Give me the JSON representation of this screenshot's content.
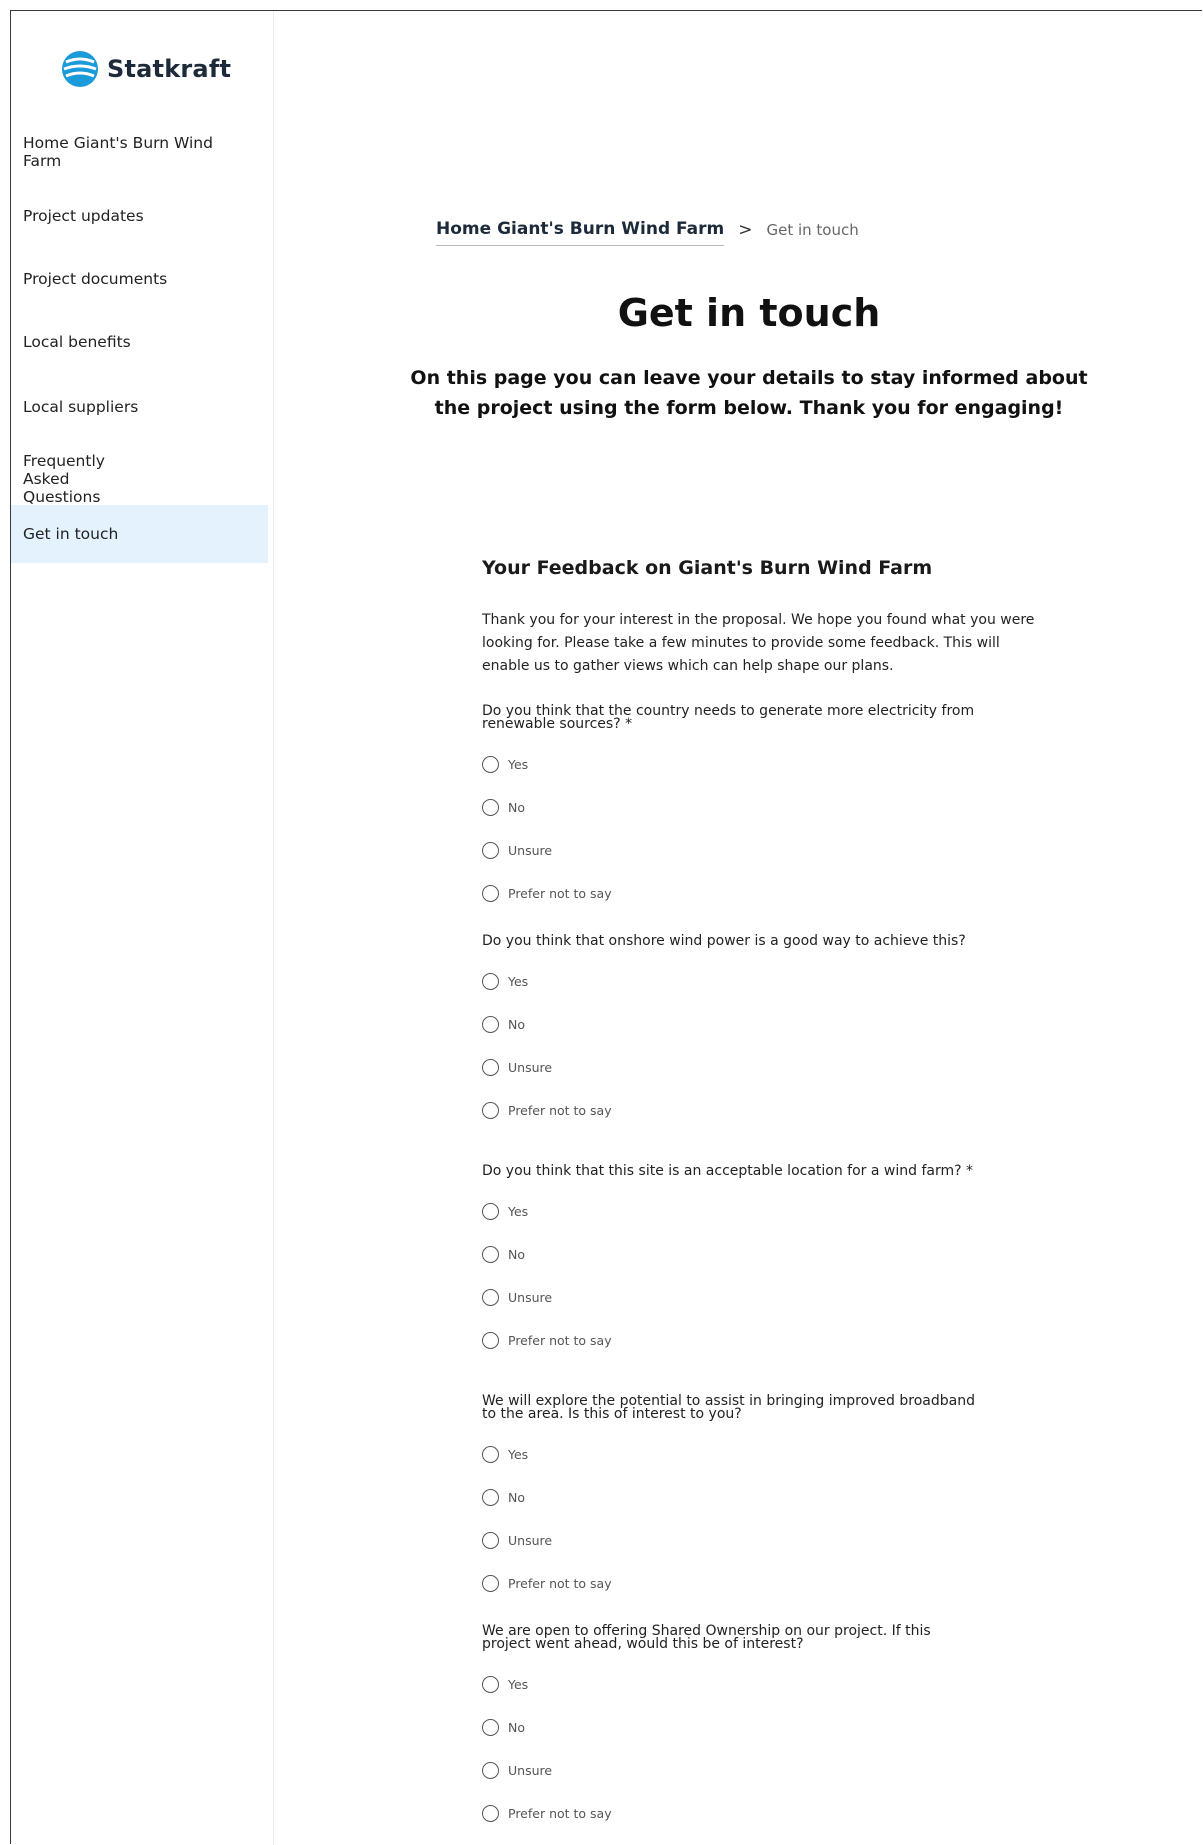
{
  "brand": {
    "name": "Statkraft",
    "color": "#1a9ad9"
  },
  "sidebar": {
    "items": [
      {
        "label": "Home Giant's Burn Wind Farm"
      },
      {
        "label": "Project updates"
      },
      {
        "label": "Project documents"
      },
      {
        "label": "Local benefits"
      },
      {
        "label": "Local suppliers"
      },
      {
        "label": "Frequently Asked Questions"
      },
      {
        "label": "Get in touch",
        "active": true
      }
    ]
  },
  "breadcrumb": {
    "home": "Home Giant's Burn Wind Farm",
    "separator": ">",
    "current": "Get in touch"
  },
  "page": {
    "title": "Get in touch",
    "intro": "On this page you can leave your details to stay informed about the project using the form below. Thank you for engaging!"
  },
  "form": {
    "title": "Your Feedback on Giant's Burn Wind Farm",
    "description": "Thank you for your interest in the proposal. We hope you found what you were looking for. Please take a few minutes to provide some feedback. This will enable us to gather views which can help shape our plans.",
    "options": [
      "Yes",
      "No",
      "Unsure",
      "Prefer not to say"
    ],
    "questions": [
      {
        "label": "Do you think that the country needs to generate more electricity from renewable sources? *"
      },
      {
        "label": "Do you think that onshore wind power is a good way to achieve this?"
      },
      {
        "label": "Do you think that this site is an acceptable location for a wind farm? *"
      },
      {
        "label": "We will explore the potential to assist in bringing improved broadband to the area. Is this of interest to you?"
      },
      {
        "label": "We are open to offering Shared Ownership on our project. If this project went ahead, would this be of interest?"
      }
    ]
  }
}
